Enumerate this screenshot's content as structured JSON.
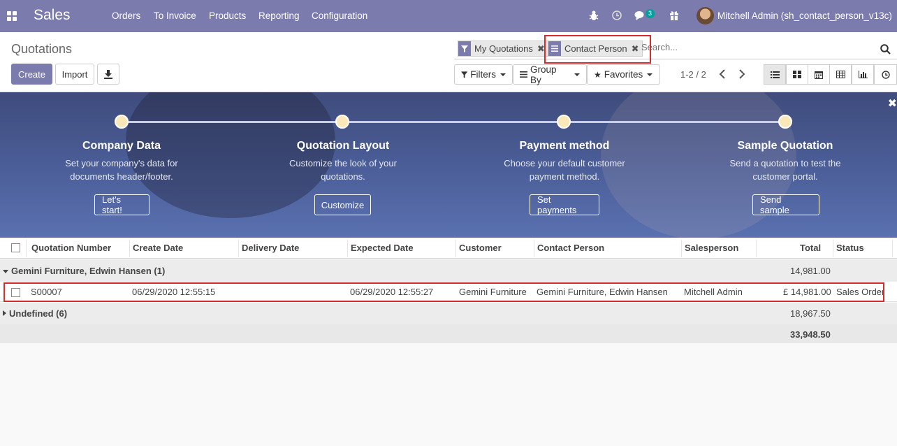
{
  "nav": {
    "brand": "Sales",
    "menu": [
      "Orders",
      "To Invoice",
      "Products",
      "Reporting",
      "Configuration"
    ],
    "chat_count": "3",
    "user": "Mitchell Admin (sh_contact_person_v13c)"
  },
  "control": {
    "title": "Quotations",
    "create": "Create",
    "import": "Import",
    "facets": [
      "My Quotations",
      "Contact Person"
    ],
    "search_placeholder": "Search...",
    "filters": "Filters",
    "group_by": "Group By",
    "favorites": "Favorites",
    "pager": "1-2 / 2"
  },
  "banner": {
    "steps": [
      {
        "title": "Company Data",
        "desc1": "Set your company's data for",
        "desc2": "documents header/footer.",
        "button": "Let's start!"
      },
      {
        "title": "Quotation Layout",
        "desc1": "Customize the look of your",
        "desc2": "quotations.",
        "button": "Customize"
      },
      {
        "title": "Payment method",
        "desc1": "Choose your default customer",
        "desc2": "payment method.",
        "button": "Set payments"
      },
      {
        "title": "Sample Quotation",
        "desc1": "Send a quotation to test the",
        "desc2": "customer portal.",
        "button": "Send sample"
      }
    ]
  },
  "table": {
    "headers": [
      "Quotation Number",
      "Create Date",
      "Delivery Date",
      "Expected Date",
      "Customer",
      "Contact Person",
      "Salesperson",
      "Total",
      "Status"
    ],
    "groups": [
      {
        "label": "Gemini Furniture, Edwin Hansen (1)",
        "total": "14,981.00"
      },
      {
        "label": "Undefined (6)",
        "total": "18,967.50"
      }
    ],
    "row": {
      "number": "S00007",
      "create_date": "06/29/2020 12:55:15",
      "delivery_date": "",
      "expected_date": "06/29/2020 12:55:27",
      "customer": "Gemini Furniture",
      "contact_person": "Gemini Furniture, Edwin Hansen",
      "salesperson": "Mitchell Admin",
      "total": "£ 14,981.00",
      "status": "Sales Order"
    },
    "grand_total": "33,948.50"
  }
}
